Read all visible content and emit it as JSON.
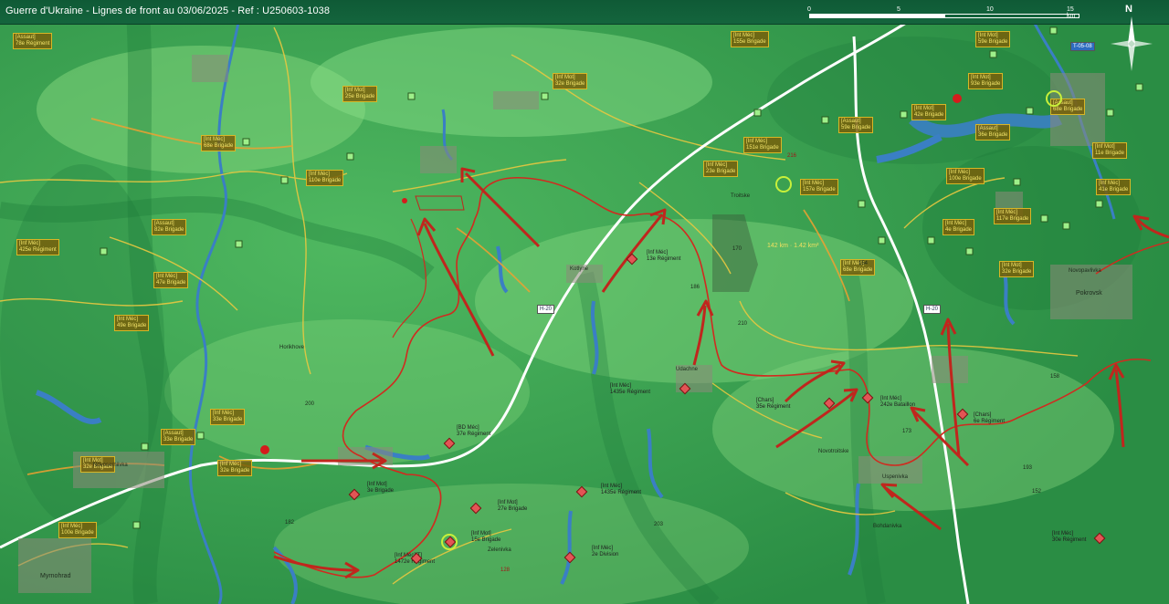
{
  "header": {
    "title": "Guerre d'Ukraine - Lignes de front au 03/06/2025 - Ref : U250603-1038",
    "scale_ticks": [
      "0",
      "5",
      "10",
      "15 km"
    ],
    "compass_label": "N"
  },
  "colors": {
    "terrain_light": "#7fd47a",
    "terrain_mid": "#3fa552",
    "terrain_dark": "#1d7a3a",
    "water": "#3a7fc4",
    "front_line": "#d12a1f",
    "road": "#e8c840",
    "highway": "#ffffff",
    "unit_label_bg": "#7a5f0a",
    "unit_label_text": "#f2e36a"
  },
  "road_shields": [
    "H-20",
    "H-20",
    "T-05-08"
  ],
  "area_stat": "142 km · 1.42 km²",
  "ukr_units": [
    "[Inf Mot]\n25e Brigade",
    "[Inf Mot]\n32e Brigade",
    "[Int Méc]\n155e Brigade",
    "[Int Méc]\n68e Brigade",
    "[Inf Méc]\n110e Brigade",
    "[Assaut]\n82e Brigade",
    "[Inf Méc]\n425e Régiment",
    "[Int Méc]\n47e Brigade",
    "[Inf Méc]\n33e Brigade",
    "[Assaut]\n33e Brigade",
    "[Inf Méc]\n32e Brigade",
    "[Inf Méc]\n100e Brigade",
    "[Inf Méc]\n151e Brigade",
    "[Int Méc]\n157e Brigade",
    "[Assaut]\n59e Brigade",
    "[Int Mot]\n42e Brigade",
    "[Int Mot]\n59e Brigade",
    "[Int Mot]\n93e Brigade",
    "[Assaut]\n36e Brigade",
    "[Inf Méc]\n100e Brigade",
    "[Int Méc]\n4e Brigade",
    "[Inf Mot]\n11e Brigade",
    "[Inf Méc]\n68e Brigade",
    "[Int Mot]\n32e Brigade",
    "[Int Méc]\n117e Brigade",
    "[Inf Méc]\n41e Brigade",
    "[Inf Méc]\n23e Brigade",
    "[Assaut]\n78e Régiment",
    "[Int Méc]\n49e Brigade",
    "[Assaut]\n68e Brigade",
    "[Int Mot]\n32e Brigade"
  ],
  "rus_units": [
    "[Inf Méc]\n13e Régiment",
    "[Int Méc]\n1435e Régiment",
    "[Chars]\n35e Régiment",
    "[Int Méc]\n242e Bataillon",
    "[Chars]\n6e Régiment",
    "[BD Méc]\n37e Régiment",
    "[Inf Mot]\n3e Brigade",
    "[Inf Mot]\n27e Brigade",
    "[Int Méc]\n1435e Régiment",
    "[Inf Méc]\n2e Division",
    "[Inf Mot]\n15e Brigade",
    "[Inf Méc][T]\n1472e Régiment",
    "[Int Méc]\n30e Régiment"
  ],
  "places": [
    "Pokrovsk",
    "Novopavlivka",
    "Kotlyne",
    "Udachne",
    "Troitske",
    "Novoserhiivka",
    "Horikhove",
    "Uspenivka",
    "Zelenivka",
    "Myrnohrad",
    "Novotroitske",
    "Bohdanivka"
  ],
  "elevations": [
    "170",
    "186",
    "210",
    "154",
    "158",
    "173",
    "193",
    "200",
    "203",
    "182",
    "152"
  ],
  "red_road_ids": [
    "128",
    "216"
  ]
}
